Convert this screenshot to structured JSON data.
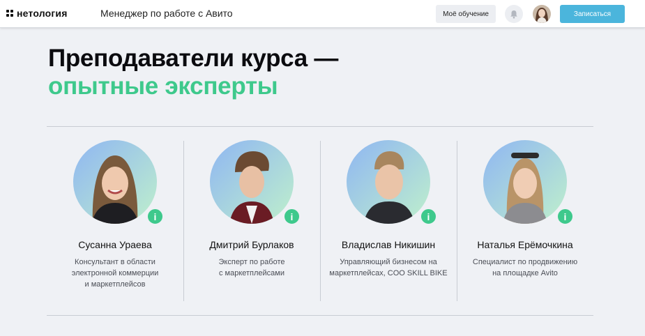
{
  "header": {
    "logo_text": "нетология",
    "course_title": "Менеджер по работе с Авито",
    "my_learning_label": "Моё обучение",
    "signup_label": "Записаться"
  },
  "section": {
    "title_line1": "Преподаватели курса —",
    "title_line2": "опытные эксперты"
  },
  "teachers": [
    {
      "name": "Сусанна Ураева",
      "desc_lines": [
        "Консультант в области",
        "электронной коммерции",
        "и маркетплейсов"
      ],
      "info_icon": "i"
    },
    {
      "name": "Дмитрий Бурлаков",
      "desc_lines": [
        "Эксперт по работе",
        "с маркетплейсами"
      ],
      "info_icon": "i"
    },
    {
      "name": "Владислав Никишин",
      "desc_lines": [
        "Управляющий бизнесом на",
        "маркетплейсах, COO SKILL BIKE"
      ],
      "info_icon": "i"
    },
    {
      "name": "Наталья Ерёмочкина",
      "desc_lines": [
        "Специалист по продвижению",
        "на площадке Avito"
      ],
      "info_icon": "i"
    }
  ],
  "colors": {
    "accent_green": "#3ec98c",
    "signup_blue": "#4bb5dc",
    "background": "#eff1f5"
  }
}
